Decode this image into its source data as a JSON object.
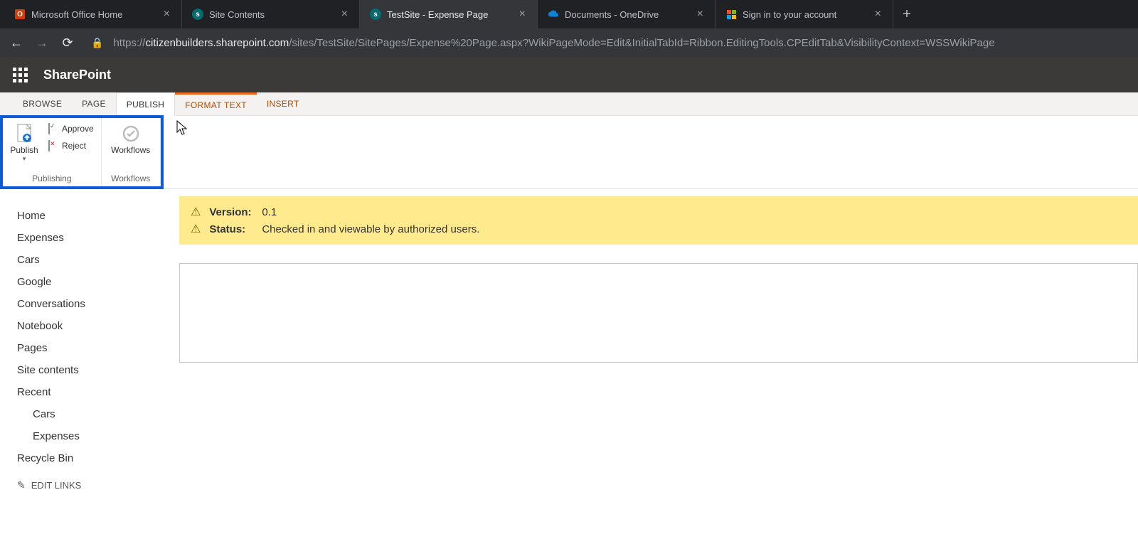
{
  "browser_tabs": [
    {
      "label": "Microsoft Office Home",
      "icon": "office"
    },
    {
      "label": "Site Contents",
      "icon": "sp"
    },
    {
      "label": "TestSite - Expense Page",
      "icon": "sp",
      "active": true
    },
    {
      "label": "Documents - OneDrive",
      "icon": "onedrive"
    },
    {
      "label": "Sign in to your account",
      "icon": "ms"
    }
  ],
  "url": {
    "scheme": "https://",
    "host": "citizenbuilders.sharepoint.com",
    "path": "/sites/TestSite/SitePages/Expense%20Page.aspx?WikiPageMode=Edit&InitialTabId=Ribbon.EditingTools.CPEditTab&VisibilityContext=WSSWikiPage"
  },
  "suite": {
    "title": "SharePoint"
  },
  "ribbon": {
    "tabs": [
      {
        "label": "BROWSE"
      },
      {
        "label": "PAGE"
      },
      {
        "label": "PUBLISH",
        "active": true
      },
      {
        "label": "FORMAT TEXT",
        "contextual": true
      },
      {
        "label": "INSERT",
        "contextual": true
      }
    ],
    "publish_btn": "Publish",
    "approve": "Approve",
    "reject": "Reject",
    "workflows_btn": "Workflows",
    "group_publishing": "Publishing",
    "group_workflows": "Workflows"
  },
  "leftnav": {
    "items": [
      "Home",
      "Expenses",
      "Cars",
      "Google",
      "Conversations",
      "Notebook",
      "Pages",
      "Site contents",
      "Recent"
    ],
    "recent_children": [
      "Cars",
      "Expenses"
    ],
    "recycle": "Recycle Bin",
    "edit_links": "EDIT LINKS"
  },
  "status": {
    "version_label": "Version:",
    "version_value": "0.1",
    "status_label": "Status:",
    "status_value": "Checked in and viewable by authorized users."
  }
}
